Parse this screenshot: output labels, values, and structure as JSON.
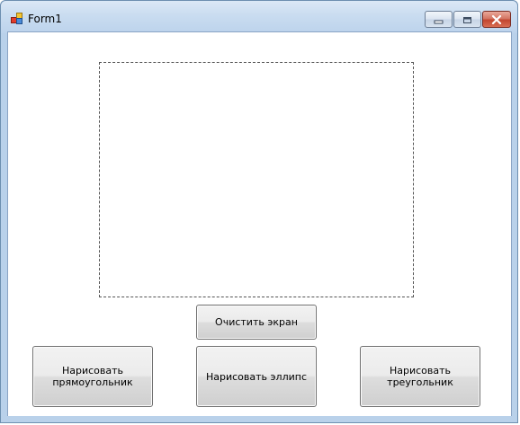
{
  "window": {
    "title": "Form1",
    "icon": "app-form-icon",
    "controls": {
      "minimize": "minimize-icon",
      "maximize": "maximize-icon",
      "close": "close-icon"
    },
    "colors": {
      "frame": "#b9d1ea",
      "close_button": "#c2462f"
    }
  },
  "canvas": {
    "border_style": "dashed"
  },
  "buttons": {
    "clear": "Очистить экран",
    "draw_rectangle": "Нарисовать\nпрямоугольник",
    "draw_ellipse": "Нарисовать эллипс",
    "draw_triangle": "Нарисовать\nтреугольник"
  }
}
